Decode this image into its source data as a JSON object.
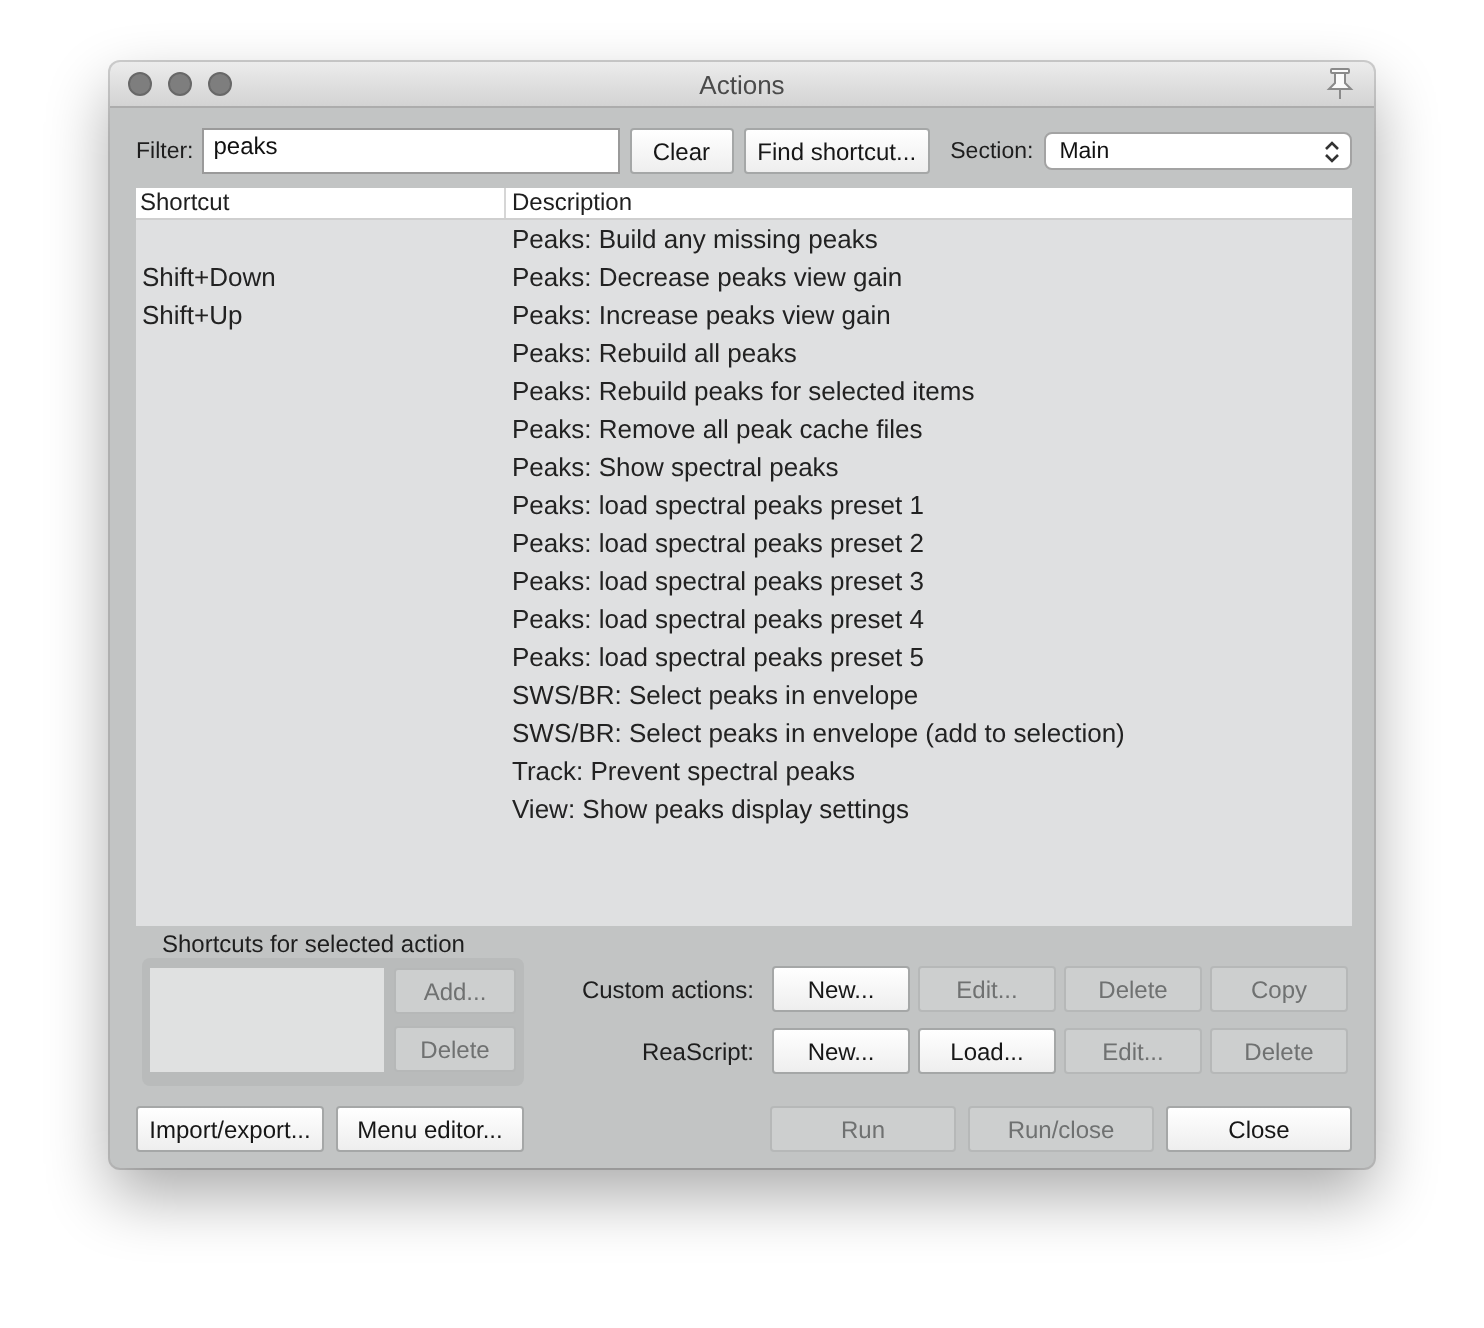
{
  "window": {
    "title": "Actions"
  },
  "filter": {
    "label": "Filter:",
    "value": "peaks"
  },
  "filter_buttons": [
    {
      "label": "Clear",
      "disabled": false
    },
    {
      "label": "Find shortcut...",
      "disabled": false
    }
  ],
  "section": {
    "label": "Section:",
    "value": "Main"
  },
  "table": {
    "columns": [
      "Shortcut",
      "Description"
    ],
    "rows": [
      {
        "description": "Peaks: Build any missing peaks"
      },
      {
        "shortcut": "Shift+Down",
        "description": "Peaks: Decrease peaks view gain"
      },
      {
        "shortcut": "Shift+Up",
        "description": "Peaks: Increase peaks view gain"
      },
      {
        "description": "Peaks: Rebuild all peaks"
      },
      {
        "description": "Peaks: Rebuild peaks for selected items"
      },
      {
        "description": "Peaks: Remove all peak cache files"
      },
      {
        "description": "Peaks: Show spectral peaks"
      },
      {
        "description": "Peaks: load spectral peaks preset 1"
      },
      {
        "description": "Peaks: load spectral peaks preset 2"
      },
      {
        "description": "Peaks: load spectral peaks preset 3"
      },
      {
        "description": "Peaks: load spectral peaks preset 4"
      },
      {
        "description": "Peaks: load spectral peaks preset 5"
      },
      {
        "description": "SWS/BR: Select peaks in envelope"
      },
      {
        "description": "SWS/BR: Select peaks in envelope (add to selection)"
      },
      {
        "description": "Track: Prevent spectral peaks"
      },
      {
        "description": "View: Show peaks display settings"
      }
    ]
  },
  "shortcuts_panel": {
    "title": "Shortcuts for selected action",
    "buttons": [
      {
        "label": "Add...",
        "disabled": true
      },
      {
        "label": "Delete",
        "disabled": true
      }
    ]
  },
  "custom_actions": {
    "label": "Custom actions:",
    "buttons": [
      {
        "label": "New...",
        "disabled": false
      },
      {
        "label": "Edit...",
        "disabled": true
      },
      {
        "label": "Delete",
        "disabled": true
      },
      {
        "label": "Copy",
        "disabled": true
      }
    ]
  },
  "reascript": {
    "label": "ReaScript:",
    "buttons": [
      {
        "label": "New...",
        "disabled": false
      },
      {
        "label": "Load...",
        "disabled": false
      },
      {
        "label": "Edit...",
        "disabled": true
      },
      {
        "label": "Delete",
        "disabled": true
      }
    ]
  },
  "footer": {
    "left_buttons": [
      {
        "label": "Import/export...",
        "disabled": false
      },
      {
        "label": "Menu editor...",
        "disabled": false
      }
    ],
    "right_buttons": [
      {
        "label": "Run",
        "disabled": true
      },
      {
        "label": "Run/close",
        "disabled": true
      },
      {
        "label": "Close",
        "disabled": false
      }
    ]
  }
}
